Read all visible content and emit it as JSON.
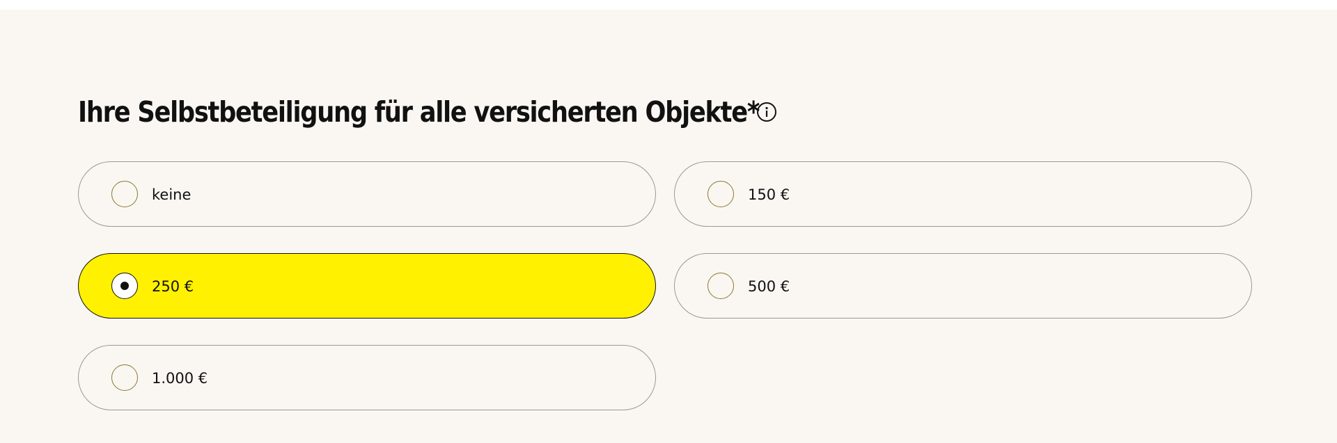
{
  "form": {
    "title": "Ihre Selbstbeteiligung für alle versicherten Objekte*",
    "info_icon": "info-circle-icon",
    "options": [
      {
        "label": "keine",
        "selected": false
      },
      {
        "label": "150 €",
        "selected": false
      },
      {
        "label": "250 €",
        "selected": true
      },
      {
        "label": "500 €",
        "selected": false
      },
      {
        "label": "1.000 €",
        "selected": false
      }
    ]
  },
  "colors": {
    "panel_background": "#faf7f3",
    "selected_background": "#fff100",
    "border": "#9a9894",
    "radio_border": "#8a7a2a",
    "text": "#111111"
  }
}
